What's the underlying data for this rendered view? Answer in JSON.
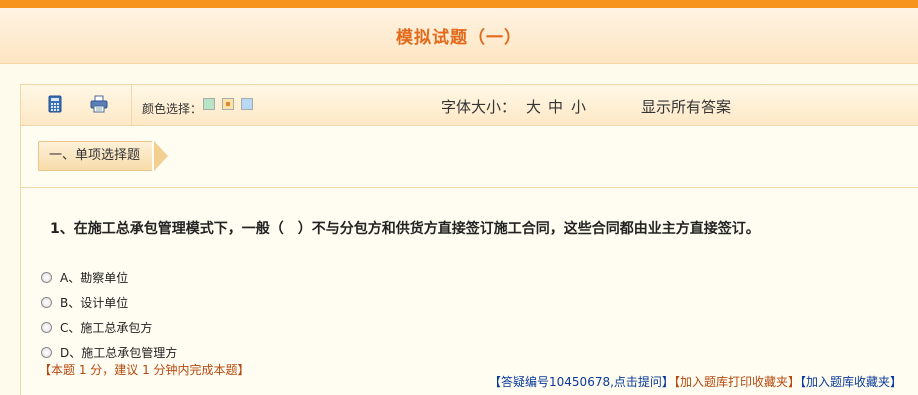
{
  "header": {
    "title": "模拟试题（一）"
  },
  "toolbar": {
    "calculator_icon": "calculator-icon",
    "printer_icon": "printer-icon",
    "color_label": "颜色选择：",
    "colors": [
      "#b7e4c7",
      "#fde3a7",
      "#b9d8f5"
    ],
    "font_size_label": "字体大小：",
    "font_sizes": [
      "大",
      "中",
      "小"
    ],
    "show_answers": "显示所有答案"
  },
  "section": {
    "label": "一、单项选择题"
  },
  "question": {
    "text": "1、在施工总承包管理模式下，一般（　）不与分包方和供货方直接签订施工合同，这些合同都由业主方直接签订。",
    "options": [
      {
        "label": "A、勘察单位"
      },
      {
        "label": "B、设计单位"
      },
      {
        "label": "C、施工总承包方"
      },
      {
        "label": "D、施工总承包管理方"
      }
    ],
    "note": "【本题 1 分，建议 1 分钟内完成本题】"
  },
  "footer": {
    "bracket_open": "【",
    "bracket_close": "】",
    "ask_link": "答疑编号10450678,点击提问",
    "print_fav": "加入题库打印收藏夹",
    "fav": "加入题库收藏夹"
  }
}
